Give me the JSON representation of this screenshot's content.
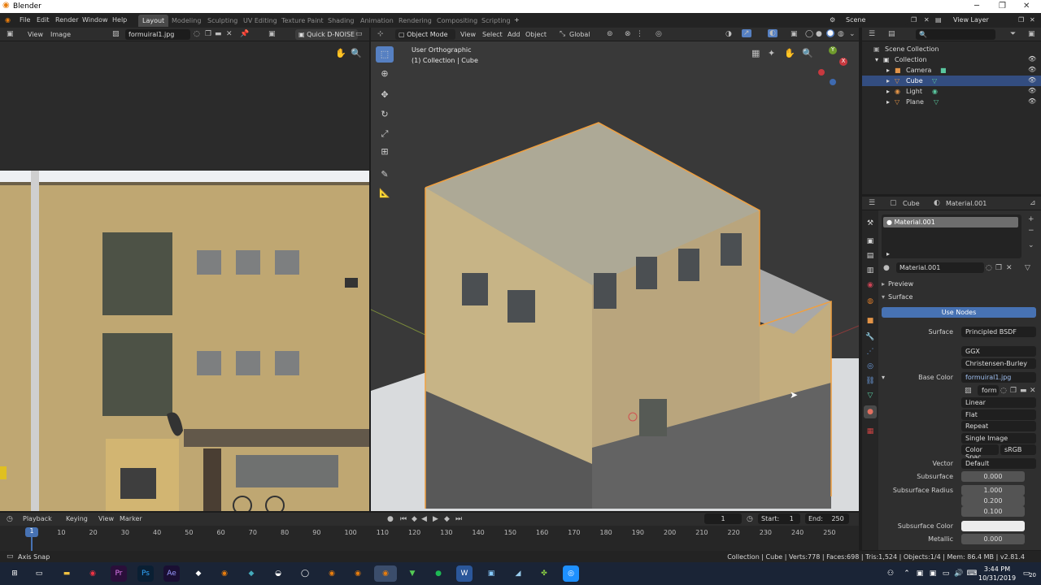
{
  "window": {
    "title": "Blender"
  },
  "menu": [
    "File",
    "Edit",
    "Render",
    "Window",
    "Help"
  ],
  "workspaces": [
    "Layout",
    "Modeling",
    "Sculpting",
    "UV Editing",
    "Texture Paint",
    "Shading",
    "Animation",
    "Rendering",
    "Compositing",
    "Scripting"
  ],
  "active_workspace": "Layout",
  "scene": {
    "name": "Scene",
    "view_layer": "View Layer"
  },
  "image_editor": {
    "menu": [
      "View",
      "Image"
    ],
    "image_name": "formuiral1.jpg",
    "denoise": "Quick D-NOISE"
  },
  "viewport": {
    "mode": "Object Mode",
    "menu": [
      "View",
      "Select",
      "Add",
      "Object"
    ],
    "transform": "Global",
    "overlay_line1": "User Orthographic",
    "overlay_line2": "(1) Collection | Cube",
    "gizmo_x": "X",
    "gizmo_y": "Y",
    "gizmo_z": "Z"
  },
  "outliner": {
    "root": "Scene Collection",
    "collection": "Collection",
    "items": [
      {
        "name": "Camera",
        "selected": false
      },
      {
        "name": "Cube",
        "selected": true
      },
      {
        "name": "Light",
        "selected": false
      },
      {
        "name": "Plane",
        "selected": false
      }
    ]
  },
  "properties": {
    "object": "Cube",
    "material_tab": "Material.001",
    "slot": "Material.001",
    "datablock": "Material.001",
    "preview": "Preview",
    "surface_panel": "Surface",
    "use_nodes": "Use Nodes",
    "fields": [
      {
        "label": "Surface",
        "value": "Principled BSDF"
      },
      {
        "label": "",
        "value": "GGX"
      },
      {
        "label": "",
        "value": "Christensen-Burley"
      },
      {
        "label": "Base Color",
        "value": "formuiral1.jpg"
      },
      {
        "label": "",
        "value": "form"
      },
      {
        "label": "",
        "value": "Linear"
      },
      {
        "label": "",
        "value": "Flat"
      },
      {
        "label": "",
        "value": "Repeat"
      },
      {
        "label": "",
        "value": "Single Image"
      },
      {
        "label": "",
        "value": "Color Spac",
        "value2": "sRGB"
      },
      {
        "label": "Vector",
        "value": "Default"
      },
      {
        "label": "Subsurface",
        "value": "0.000"
      },
      {
        "label": "Subsurface Radius",
        "value": "1.000"
      },
      {
        "label": "",
        "value": "0.200"
      },
      {
        "label": "",
        "value": "0.100"
      },
      {
        "label": "Subsurface Color",
        "value": ""
      },
      {
        "label": "Metallic",
        "value": "0.000"
      }
    ]
  },
  "timeline": {
    "menu": [
      "Playback",
      "Keying",
      "View",
      "Marker"
    ],
    "current": "1",
    "start_label": "Start:",
    "start": "1",
    "end_label": "End:",
    "end": "250",
    "ticks": [
      "10",
      "20",
      "30",
      "40",
      "50",
      "60",
      "70",
      "80",
      "90",
      "100",
      "110",
      "120",
      "130",
      "140",
      "150",
      "160",
      "170",
      "180",
      "190",
      "200",
      "210",
      "220",
      "230",
      "240",
      "250"
    ],
    "playhead": "1"
  },
  "status": {
    "left": "Axis Snap",
    "right": "Collection | Cube | Verts:778 | Faces:698 | Tris:1,524 | Objects:1/4 | Mem: 86.4 MB | v2.81.4"
  },
  "taskbar": {
    "time": "3:44 PM",
    "date": "10/31/2019",
    "notif": "20"
  },
  "colors": {
    "accent": "#5680c2",
    "selection": "#334d80",
    "header": "#2d2d2d",
    "outline": "#f0a040"
  }
}
